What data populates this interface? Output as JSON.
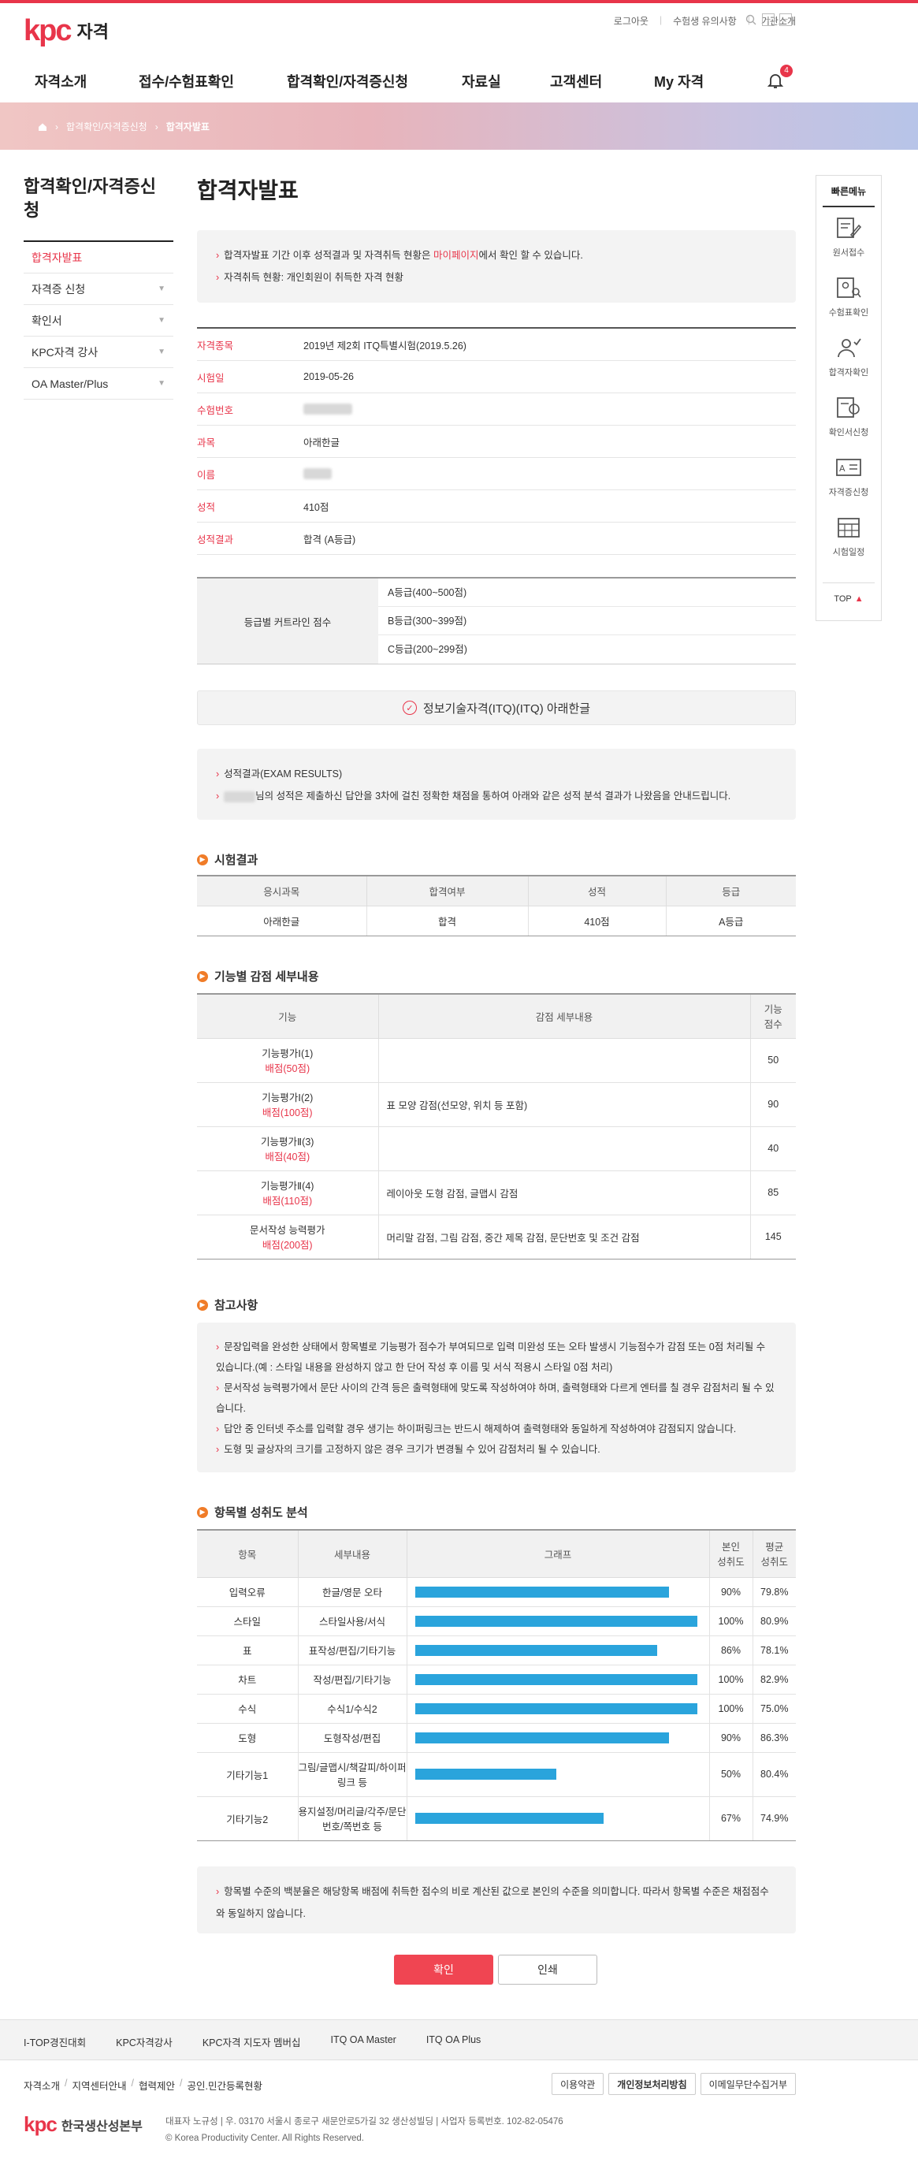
{
  "header": {
    "logo_mark": "kpc",
    "logo_text": "자격",
    "util_links": [
      "로그아웃",
      "수험생 유의사항",
      "기관소개"
    ],
    "nav": [
      "자격소개",
      "접수/수험표확인",
      "합격확인/자격증신청",
      "자료실",
      "고객센터",
      "My 자격"
    ],
    "notification_count": "4"
  },
  "breadcrumb": [
    "홈",
    "합격확인/자격증신청",
    "합격자발표"
  ],
  "lnb": {
    "title": "합격확인/자격증신청",
    "items": [
      {
        "label": "합격자발표",
        "active": true
      },
      {
        "label": "자격증 신청",
        "active": false
      },
      {
        "label": "확인서",
        "active": false
      },
      {
        "label": "KPC자격 강사",
        "active": false
      },
      {
        "label": "OA Master/Plus",
        "active": false
      }
    ]
  },
  "page_title": "합격자발표",
  "notice": {
    "line1_pre": "합격자발표 기간 이후 성적결과 및 자격취득 현황은 ",
    "line1_link": "마이페이지",
    "line1_post": "에서 확인 할 수 있습니다.",
    "line2": "자격취득 현황: 개인회원이 취득한 자격 현황"
  },
  "info_rows": [
    {
      "key": "자격종목",
      "value": "2019년 제2회 ITQ특별시험(2019.5.26)"
    },
    {
      "key": "시험일",
      "value": "2019-05-26"
    },
    {
      "key": "수험번호",
      "value": ""
    },
    {
      "key": "과목",
      "value": "아래한글"
    },
    {
      "key": "이름",
      "value": ""
    },
    {
      "key": "성적",
      "value": "410점"
    },
    {
      "key": "성적결과",
      "value": "합격 (A등급)"
    }
  ],
  "cutline": {
    "label": "등급별 커트라인 점수",
    "values": [
      "A등급(400~500점)",
      "B등급(300~399점)",
      "C등급(200~299점)"
    ]
  },
  "cert_banner": "정보기술자격(ITQ)(ITQ) 아래한글",
  "results_box": {
    "line1": "성적결과(EXAM RESULTS)",
    "line2": "님의 성적은 제출하신 답안을 3차에 걸친 정확한 채점을 통하여 아래와 같은 성적 분석 결과가 나왔음을 안내드립니다."
  },
  "exam_result": {
    "title": "시험결과",
    "headers": [
      "응시과목",
      "합격여부",
      "성적",
      "등급"
    ],
    "row": [
      "아래한글",
      "합격",
      "410점",
      "A등급"
    ]
  },
  "deductions": {
    "title": "기능별 감점 세부내용",
    "headers": [
      "기능",
      "감점 세부내용",
      "기능\n점수"
    ],
    "rows": [
      {
        "name": "기능평가Ⅰ(1)",
        "alloc": "배점(50점)",
        "detail": "",
        "score": "50"
      },
      {
        "name": "기능평가Ⅰ(2)",
        "alloc": "배점(100점)",
        "detail": "표 모양 감점(선모양, 위치 등 포함)",
        "score": "90"
      },
      {
        "name": "기능평가Ⅱ(3)",
        "alloc": "배점(40점)",
        "detail": "",
        "score": "40"
      },
      {
        "name": "기능평가Ⅱ(4)",
        "alloc": "배점(110점)",
        "detail": "레이아웃 도형 감점, 글맵시 감점",
        "score": "85"
      },
      {
        "name": "문서작성 능력평가",
        "alloc": "배점(200점)",
        "detail": "머리말 감점, 그림 감점, 중간 제목 감점, 문단번호 및 조건 감점",
        "score": "145"
      }
    ]
  },
  "reference": {
    "title": "참고사항",
    "items": [
      "문장입력을 완성한 상태에서 항목별로 기능평가 점수가 부여되므로 입력 미완성 또는 오타 발생시 기능점수가 감점 또는 0점 처리될 수 있습니다.(예 : 스타일 내용을 완성하지 않고 한 단어 작성 후 이름 및 서식 적용시 스타일 0점 처리)",
      "문서작성 능력평가에서 문단 사이의 간격 등은 출력형태에 맞도록 작성하여야 하며, 출력형태와 다르게 엔터를 칠 경우 감점처리 될 수 있습니다.",
      "답안 중 인터넷 주소를 입력할 경우 생기는 하이퍼링크는 반드시 해제하여 출력형태와 동일하게 작성하여야 감점되지 않습니다.",
      "도형 및 글상자의 크기를 고정하지 않은 경우 크기가 변경될 수 있어 감점처리 될 수 있습니다."
    ]
  },
  "achievement": {
    "title": "항목별 성취도 분석",
    "headers": [
      "항목",
      "세부내용",
      "그래프",
      "본인\n성취도",
      "평균\n성취도"
    ],
    "bar_color": "#2aa4dc",
    "rows": [
      {
        "item": "입력오류",
        "detail": "한글/영문 오타",
        "self": 90,
        "self_label": "90%",
        "avg": "79.8%"
      },
      {
        "item": "스타일",
        "detail": "스타일사용/서식",
        "self": 100,
        "self_label": "100%",
        "avg": "80.9%"
      },
      {
        "item": "표",
        "detail": "표작성/편집/기타기능",
        "self": 86,
        "self_label": "86%",
        "avg": "78.1%"
      },
      {
        "item": "차트",
        "detail": "작성/편집/기타기능",
        "self": 100,
        "self_label": "100%",
        "avg": "82.9%"
      },
      {
        "item": "수식",
        "detail": "수식1/수식2",
        "self": 100,
        "self_label": "100%",
        "avg": "75.0%"
      },
      {
        "item": "도형",
        "detail": "도형작성/편집",
        "self": 90,
        "self_label": "90%",
        "avg": "86.3%"
      },
      {
        "item": "기타기능1",
        "detail": "그림/글맵시/책갈피/하이퍼링크 등",
        "self": 50,
        "self_label": "50%",
        "avg": "80.4%"
      },
      {
        "item": "기타기능2",
        "detail": "용지설정/머리글/각주/문단번호/쪽번호 등",
        "self": 67,
        "self_label": "67%",
        "avg": "74.9%"
      }
    ]
  },
  "bottom_notice": "항목별 수준의 백분율은 해당항목 배점에 취득한 점수의 비로 계산된 값으로 본인의 수준을 의미합니다. 따라서 항목별 수준은 채점점수와 동일하지 않습니다.",
  "buttons": {
    "confirm": "확인",
    "print": "인쇄"
  },
  "quick_menu": {
    "title": "빠른메뉴",
    "items": [
      "원서접수",
      "수험표확인",
      "합격자확인",
      "확인서신청",
      "자격증신청",
      "시험일정"
    ],
    "top": "TOP"
  },
  "footer": {
    "links": [
      "I-TOP경진대회",
      "KPC자격강사",
      "KPC자격 지도자 멤버십",
      "ITQ OA Master",
      "ITQ OA Plus"
    ],
    "sub_links": [
      "자격소개",
      "지역센터안내",
      "협력제안",
      "공인.민간등록현황"
    ],
    "policy_buttons": [
      "이용약관",
      "개인정보처리방침",
      "이메일무단수집거부"
    ],
    "org_name": "한국생산성본부",
    "address": "대표자 노규성 | 우. 03170 서울시 종로구 새문안로5가길 32 생산성빌딩 | 사업자 등록번호. 102-82-05476",
    "copyright": "© Korea Productivity Center. All Rights Reserved."
  }
}
